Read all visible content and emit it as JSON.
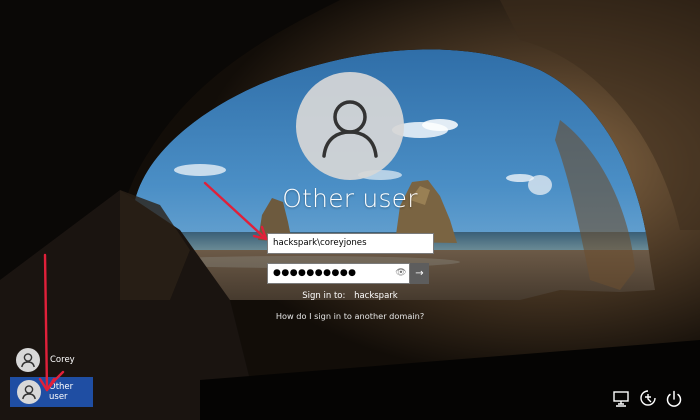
{
  "screen": {
    "title": "Other user",
    "username_value": "hackspark\\coreyjones",
    "password_value": "●●●●●●●●●●",
    "reveal_icon": "eye-icon",
    "submit_icon": "arrow-right-icon",
    "signin_to_label": "Sign in to:",
    "signin_to_domain": "hackspark",
    "help_link": "How do I sign in to another domain?"
  },
  "users": [
    {
      "name": "Corey",
      "icon": "user-icon"
    },
    {
      "name": "Other user",
      "icon": "user-icon",
      "selected": true
    }
  ],
  "system_buttons": [
    {
      "icon": "network-icon"
    },
    {
      "icon": "ease-of-access-icon"
    },
    {
      "icon": "power-icon"
    }
  ],
  "colors": {
    "selected_tile": "#1f4ea3",
    "annotation_arrow": "#e0203a",
    "text": "#ffffff"
  }
}
